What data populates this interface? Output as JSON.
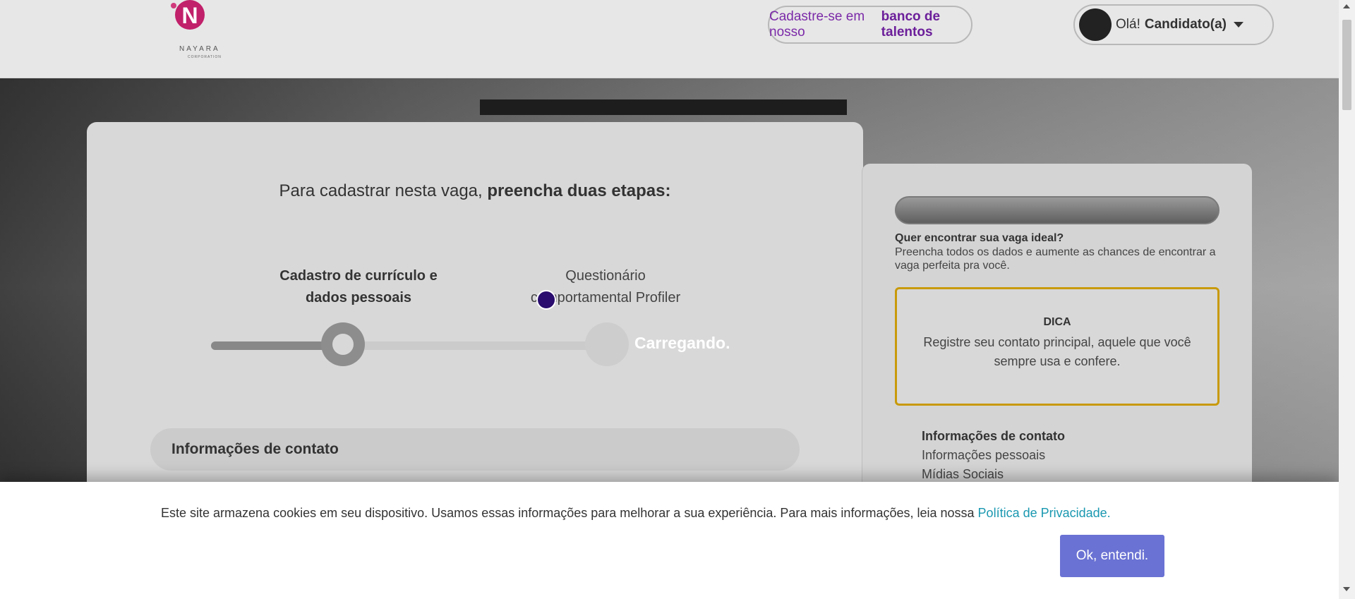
{
  "header": {
    "logo_letter": "N",
    "logo_name": "NAYARA",
    "logo_sub": "CORPORATION",
    "talent_prefix": "Cadastre-se em nosso",
    "talent_link": "banco de talentos",
    "greeting": "Olá!",
    "user_name": "Candidato(a)"
  },
  "main": {
    "title_prefix": "Para cadastrar nesta vaga,",
    "title_bold": "preencha duas etapas:",
    "step1_line1": "Cadastro de currículo e",
    "step1_line2": "dados pessoais",
    "step2_line1": "Questionário",
    "step2_line2": "comportamental Profiler",
    "loading": "Carregando.",
    "section_title": "Informações de contato"
  },
  "side": {
    "heading": "Quer encontrar sua vaga ideal?",
    "text": "Preencha todos os dados e aumente as chances de encontrar a vaga perfeita pra você.",
    "tip_title": "DICA",
    "tip_text": "Registre seu contato principal, aquele que você sempre usa e confere.",
    "list": [
      "Informações de contato",
      "Informações pessoais",
      "Mídias Sociais"
    ]
  },
  "cookie": {
    "text": "Este site armazena cookies em seu dispositivo. Usamos essas informações para melhorar a sua experiência. Para mais informações, leia nossa",
    "link": "Política de Privacidade.",
    "button": "Ok, entendi."
  },
  "colors": {
    "brand": "#c1206a",
    "talent_link": "#6c1f9a",
    "tip_border": "#c89a0a",
    "cookie_link": "#1a98b0",
    "ok_button": "#6a72d3"
  },
  "icons": [
    "caret-down-icon",
    "avatar"
  ]
}
